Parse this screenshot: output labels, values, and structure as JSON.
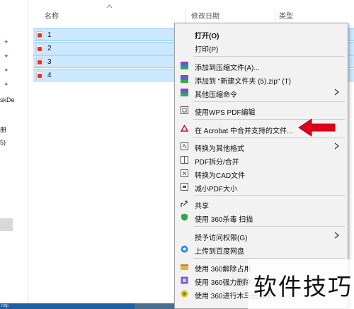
{
  "explorer": {
    "columns": {
      "name": "名称",
      "modified": "修改日期",
      "type": "类型"
    },
    "files": [
      {
        "name": "1"
      },
      {
        "name": "2"
      },
      {
        "name": "3"
      },
      {
        "name": "4"
      }
    ],
    "nav_fragments": [
      "skDe",
      "册",
      "5)"
    ],
    "taskbar_text": "http"
  },
  "context_menu": {
    "items": [
      {
        "label": "打开(O)",
        "icon": "none",
        "bold": true
      },
      {
        "label": "打印(P)",
        "icon": "none"
      },
      {
        "label": "添加到压缩文件(A)...",
        "icon": "archive-icon"
      },
      {
        "label": "添加到 \"新建文件夹 (5).zip\" (T)",
        "icon": "archive-icon"
      },
      {
        "label": "其他压缩命令",
        "icon": "archive-icon",
        "submenu": true
      },
      {
        "label": "使用WPS PDF编辑",
        "icon": "wps-pdf-icon"
      },
      {
        "label": "在 Acrobat 中合并支持的文件...",
        "icon": "acrobat-icon"
      },
      {
        "label": "转换为其他格式",
        "icon": "convert-icon",
        "submenu": true
      },
      {
        "label": "PDF拆分/合并",
        "icon": "pdf-split-icon"
      },
      {
        "label": "转换为CAD文件",
        "icon": "cad-icon"
      },
      {
        "label": "减小PDF大小",
        "icon": "compress-pdf-icon"
      },
      {
        "label": "共享",
        "icon": "share-icon"
      },
      {
        "label": "使用 360杀毒 扫描",
        "icon": "360-antivirus-icon"
      },
      {
        "label": "授予访问权限(G)",
        "icon": "none",
        "submenu": true
      },
      {
        "label": "上传到百度网盘",
        "icon": "baidu-cloud-icon"
      },
      {
        "label": "使用 360解除占用",
        "icon": "360-unlock-icon"
      },
      {
        "label": "使用 360强力删除",
        "icon": "360-delete-icon"
      },
      {
        "label": "使用 360进行木马云查杀",
        "icon": "360-scan-icon"
      }
    ]
  },
  "watermark": {
    "text": "软件技巧"
  },
  "colors": {
    "selection": "#cce8ff",
    "selection_border": "#99d1ff",
    "menu_bg": "#f2f2f2",
    "annotation_arrow": "#e0001a"
  }
}
